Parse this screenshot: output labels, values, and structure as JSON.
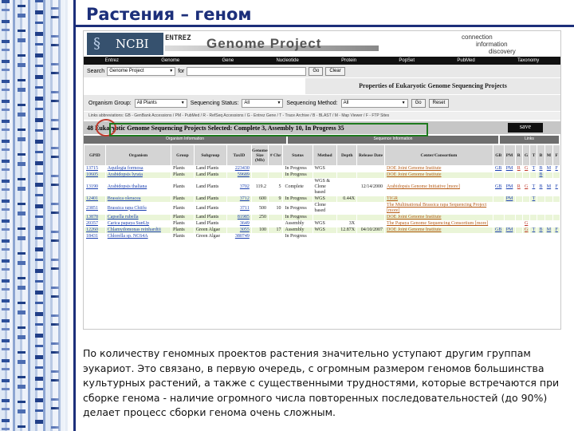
{
  "slide": {
    "title": "Растения – геном",
    "body": "По количеству геномных проектов растения значительно уступают другим группам эукариот. Это связано, в первую очередь, с огромным размером геномов большинства культурных растений, а также с существенными трудностями, которые встречаются при сборке генома - наличие огромного числа повторенных последовательностей (до 90%) делает процесс сборки генома очень сложным."
  },
  "header": {
    "logo": "NCBI",
    "entrez": "ENTREZ",
    "title": "Genome Project",
    "slogan": [
      "connection",
      "information",
      "discovery"
    ]
  },
  "nav": [
    "Entrez",
    "Genome",
    "Gene",
    "Nucleotide",
    "Protein",
    "PopSet",
    "PubMed",
    "Taxonomy"
  ],
  "search": {
    "label": "Search",
    "db": "Genome Project",
    "for_label": "for",
    "go": "Go",
    "clear": "Clear"
  },
  "props_title": "Properties of Eukaryotic Genome Sequencing Projects",
  "filters": {
    "group_label": "Organism Group:",
    "group_value": "All Plants",
    "status_label": "Sequencing Status:",
    "status_value": "All",
    "method_label": "Sequencing Method:",
    "method_value": "All",
    "go": "Go",
    "reset": "Reset"
  },
  "links_line": "Links abbreviations: GB - GenBank Accessions / PM - PubMed / R - RefSeq Accessions / G - Entrez Gene / T - Trace Archive / B - BLAST / M - Map Viewer / F - FTP Sites",
  "count_line": "48 Eukaryotic Genome Sequencing Projects Selected: Complete   3, Assembly   10, In Progress   35",
  "save": "save",
  "sections": {
    "organism": "Organism Information",
    "sequence": "Sequence Information",
    "links": "Links"
  },
  "columns": [
    "GPID",
    "Organism",
    "Group",
    "Subgroup",
    "TaxID",
    "Genome Size (Mb)",
    "# Chr",
    "Status",
    "Method",
    "Depth",
    "Release Date",
    "Center/Consortium",
    "GB",
    "PM",
    "R",
    "G",
    "T",
    "B",
    "M",
    "F"
  ],
  "rows": [
    {
      "gpid": "13715",
      "organism": "Aquilegia formosa",
      "group": "Plants",
      "subgroup": "Land Plants",
      "taxid": "223430",
      "size": "",
      "chr": "",
      "status": "In Progress",
      "method": "WGS",
      "depth": "",
      "date": "",
      "center": "DOE Joint Genome Institute",
      "links": [
        "GB",
        "PM",
        "R",
        "G",
        "T",
        "B",
        "M",
        "F"
      ]
    },
    {
      "gpid": "10605",
      "organism": "Arabidopsis lyrata",
      "group": "Plants",
      "subgroup": "Land Plants",
      "taxid": "59689",
      "size": "",
      "chr": "",
      "status": "In Progress",
      "method": "",
      "depth": "",
      "date": "",
      "center": "DOE Joint Genome Institute",
      "links": [
        "",
        "",
        "",
        "",
        "",
        "B",
        "",
        ""
      ]
    },
    {
      "gpid": "13190",
      "organism": "Arabidopsis thaliana",
      "group": "Plants",
      "subgroup": "Land Plants",
      "taxid": "3702",
      "size": "119.2",
      "chr": "5",
      "status": "Complete",
      "method": "WGS & Clone based",
      "depth": "",
      "date": "12/14/2000",
      "center": "Arabidopsis Genome Initiative [more]",
      "links": [
        "GB",
        "PM",
        "R",
        "G",
        "T",
        "B",
        "M",
        "F"
      ]
    },
    {
      "gpid": "12401",
      "organism": "Brassica oleracea",
      "group": "Plants",
      "subgroup": "Land Plants",
      "taxid": "3712",
      "size": "600",
      "chr": "9",
      "status": "In Progress",
      "method": "WGS",
      "depth": "0.44X",
      "date": "",
      "center": "TIGR",
      "links": [
        "",
        "PM",
        "",
        "",
        "T",
        "",
        "",
        ""
      ]
    },
    {
      "gpid": "23851",
      "organism": "Brassica rapa Chiifu",
      "group": "Plants",
      "subgroup": "Land Plants",
      "taxid": "3711",
      "size": "500",
      "chr": "10",
      "status": "In Progress",
      "method": "Clone based",
      "depth": "",
      "date": "",
      "center": "The Multinational Brassica rapa Sequencing Project [more]",
      "links": [
        "",
        "",
        "",
        "",
        "",
        "",
        "",
        ""
      ]
    },
    {
      "gpid": "13878",
      "organism": "Capsella rubella",
      "group": "Plants",
      "subgroup": "Land Plants",
      "taxid": "81985",
      "size": "250",
      "chr": "",
      "status": "In Progress",
      "method": "",
      "depth": "",
      "date": "",
      "center": "DOE Joint Genome Institute",
      "links": [
        "",
        "",
        "",
        "",
        "",
        "",
        "",
        ""
      ]
    },
    {
      "gpid": "20357",
      "organism": "Carica papaya SunUp",
      "group": "Plants",
      "subgroup": "Land Plants",
      "taxid": "3649",
      "size": "",
      "chr": "",
      "status": "Assembly",
      "method": "WGS",
      "depth": "3X",
      "date": "",
      "center": "The Papaya Genome Sequencing Consortium [more]",
      "links": [
        "",
        "",
        "",
        "G",
        "",
        "",
        "",
        ""
      ]
    },
    {
      "gpid": "12260",
      "organism": "Chlamydomonas reinhardtii",
      "group": "Plants",
      "subgroup": "Green Algae",
      "taxid": "3055",
      "size": "100",
      "chr": "17",
      "status": "Assembly",
      "method": "WGS",
      "depth": "12.87X",
      "date": "04/10/2007",
      "center": "DOE Joint Genome Institute",
      "links": [
        "GB",
        "PM",
        "",
        "G",
        "T",
        "B",
        "M",
        "F"
      ]
    },
    {
      "gpid": "18431",
      "organism": "Chlorella sp. NC64A",
      "group": "Plants",
      "subgroup": "Green Algae",
      "taxid": "380749",
      "size": "",
      "chr": "",
      "status": "In Progress",
      "method": "",
      "depth": "",
      "date": "",
      "center": "",
      "links": [
        "",
        "",
        "",
        "",
        "",
        "",
        "",
        ""
      ]
    }
  ]
}
